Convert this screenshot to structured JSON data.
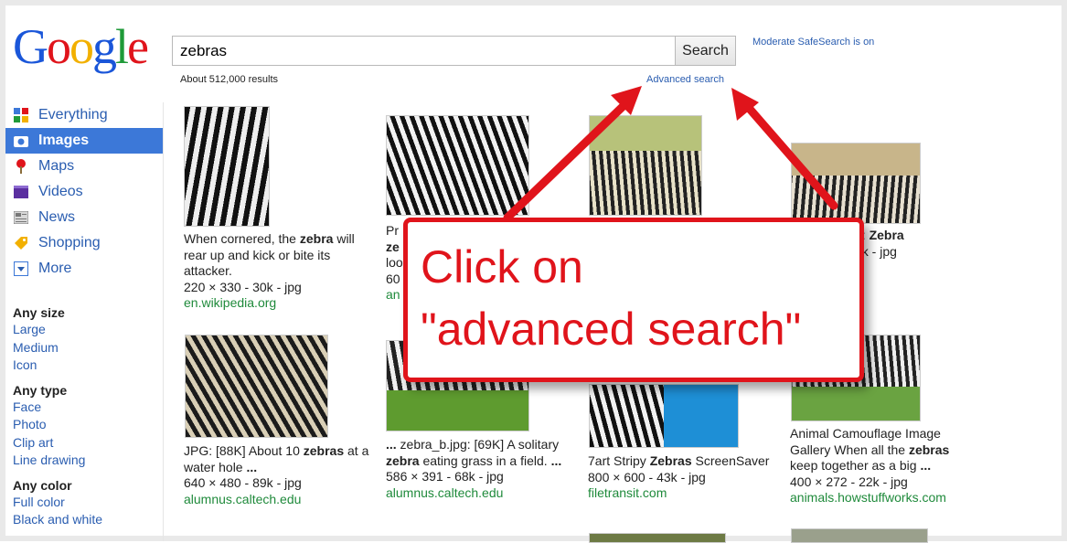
{
  "logo": {
    "letters": [
      "G",
      "o",
      "o",
      "g",
      "l",
      "e"
    ],
    "colors": [
      "#1a56d9",
      "#e0141b",
      "#f2b000",
      "#1a56d9",
      "#1f9a38",
      "#e0141b"
    ]
  },
  "search": {
    "query": "zebras",
    "button": "Search"
  },
  "safesearch": "Moderate SafeSearch is on",
  "results_count": "About 512,000 results",
  "advanced_search": "Advanced search",
  "nav": [
    {
      "label": "Everything",
      "icon": "everything-icon"
    },
    {
      "label": "Images",
      "icon": "camera-icon",
      "active": true
    },
    {
      "label": "Maps",
      "icon": "map-pin-icon"
    },
    {
      "label": "Videos",
      "icon": "video-icon"
    },
    {
      "label": "News",
      "icon": "news-icon"
    },
    {
      "label": "Shopping",
      "icon": "tag-icon"
    },
    {
      "label": "More",
      "icon": "dropdown-icon"
    }
  ],
  "filters": [
    {
      "title": "Any size",
      "links": [
        "Large",
        "Medium",
        "Icon"
      ]
    },
    {
      "title": "Any type",
      "links": [
        "Face",
        "Photo",
        "Clip art",
        "Line drawing"
      ]
    },
    {
      "title": "Any color",
      "links": [
        "Full color",
        "Black and white"
      ]
    }
  ],
  "captions": {
    "c1": {
      "pre": "When cornered, the ",
      "b": "zebra",
      "post": " will rear up and kick or bite its attacker.",
      "meta": "220 × 330 - 30k - jpg",
      "src": "en.wikipedia.org"
    },
    "c2": {
      "l1": "Pr",
      "l2": "ze",
      "l3": "loo",
      "l4": "60",
      "src": "an"
    },
    "c4": {
      "pre": "e: ",
      "b": "Zebra",
      "meta": "4k - jpg"
    },
    "c5": {
      "pre": "JPG: [88K] About 10 ",
      "b": "zebras",
      "post": " at a water hole ",
      "b2": "...",
      "meta": "640 × 480 - 89k - jpg",
      "src": "alumnus.caltech.edu"
    },
    "c6": {
      "b1": "...",
      "pre": " zebra_b.jpg: [69K] A solitary ",
      "b": "zebra",
      "post": " eating grass in a field. ",
      "b2": "...",
      "meta": "586 × 391 - 68k - jpg",
      "src": "alumnus.caltech.edu"
    },
    "c7": {
      "pre": "7art Stripy ",
      "b": "Zebras",
      "post": " ScreenSaver",
      "meta": "800 × 600 - 43k - jpg",
      "src": "filetransit.com"
    },
    "c8": {
      "pre": "Animal Camouflage Image Gallery When all the ",
      "b": "zebras",
      "post": " keep together as a big ",
      "b2": "...",
      "meta": "400 × 272 - 22k - jpg",
      "src": "animals.howstuffworks.com"
    }
  },
  "callout": {
    "line1": "Click on",
    "line2": "\"advanced search\""
  }
}
